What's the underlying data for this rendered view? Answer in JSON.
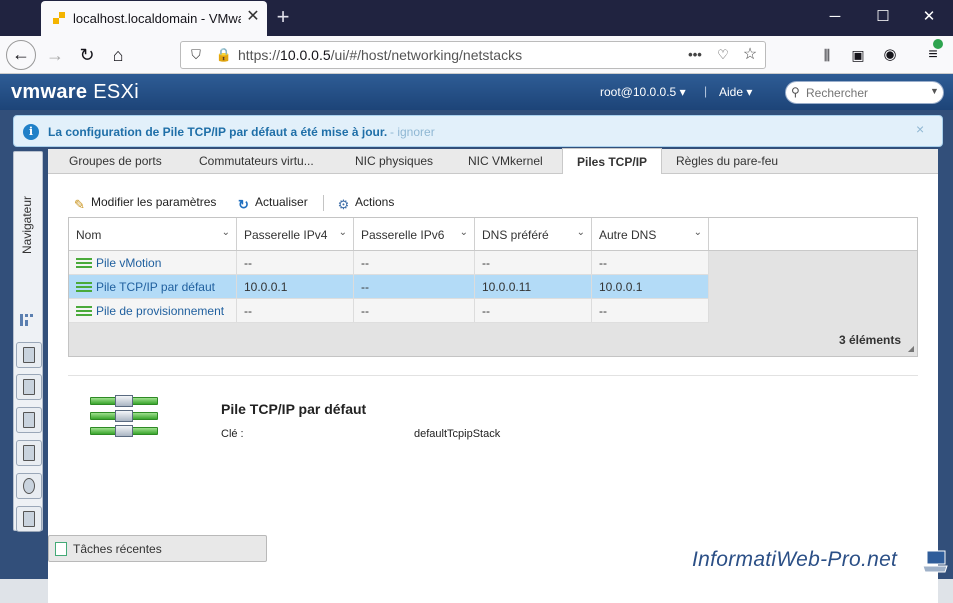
{
  "browser": {
    "tab_title": "localhost.localdomain - VMware ESXi",
    "url_prefix": "https://",
    "url_host": "10.0.0.5",
    "url_path": "/ui/#/host/networking/netstacks",
    "url_more": "•••"
  },
  "header": {
    "logo_vm": "vmware",
    "logo_product": "ESXi",
    "user": "root@10.0.0.5 ▾",
    "separator": "|",
    "help": "Aide ▾",
    "search_placeholder": "Rechercher"
  },
  "banner": {
    "message": "La configuration de Pile TCP/IP par défaut a été mise à jour.",
    "link": " - ignorer",
    "close": "×"
  },
  "navigator": {
    "label": "Navigateur"
  },
  "tabs": [
    {
      "label": "Groupes de ports"
    },
    {
      "label": "Commutateurs virtu..."
    },
    {
      "label": "NIC physiques"
    },
    {
      "label": "NIC VMkernel"
    },
    {
      "label": "Piles TCP/IP"
    },
    {
      "label": "Règles du pare-feu"
    }
  ],
  "toolbar": {
    "edit": "Modifier les paramètres",
    "refresh": "Actualiser",
    "actions": "Actions"
  },
  "grid": {
    "columns": [
      "Nom",
      "Passerelle IPv4",
      "Passerelle IPv6",
      "DNS préféré",
      "Autre DNS"
    ],
    "rows": [
      {
        "name": "Pile vMotion",
        "ipv4": "--",
        "ipv6": "--",
        "dns": "--",
        "alt_dns": "--"
      },
      {
        "name": "Pile TCP/IP par défaut",
        "ipv4": "10.0.0.1",
        "ipv6": "--",
        "dns": "10.0.0.11",
        "alt_dns": "10.0.0.1"
      },
      {
        "name": "Pile de provisionnement",
        "ipv4": "--",
        "ipv6": "--",
        "dns": "--",
        "alt_dns": "--"
      }
    ],
    "count": "3 éléments"
  },
  "detail": {
    "title": "Pile TCP/IP par défaut",
    "key_label": "Clé :",
    "key_value": "defaultTcpipStack"
  },
  "tasks": {
    "label": "Tâches récentes"
  },
  "watermark": "InformatiWeb-Pro.net",
  "colors": {
    "header": "#1d4478",
    "selected_row": "#b3dbf7",
    "link": "#1f5f9e",
    "banner_bg": "#e2f0fa"
  }
}
